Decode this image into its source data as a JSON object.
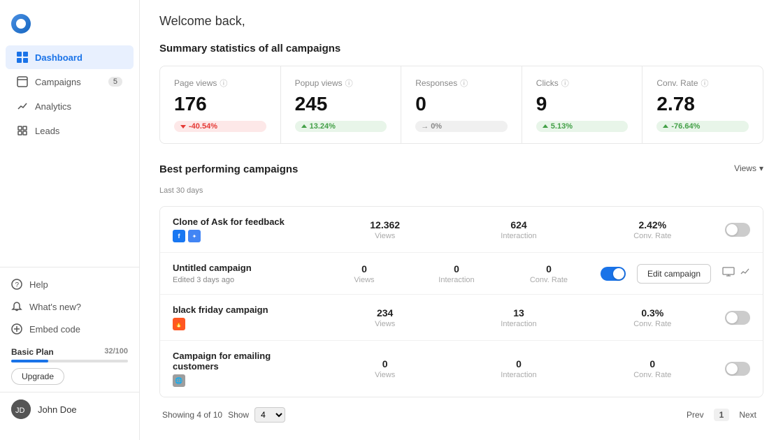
{
  "app": {
    "logo_label": "App Logo"
  },
  "sidebar": {
    "nav_items": [
      {
        "id": "dashboard",
        "label": "Dashboard",
        "icon": "⊞",
        "active": true,
        "badge": null
      },
      {
        "id": "campaigns",
        "label": "Campaigns",
        "icon": "☐",
        "active": false,
        "badge": "5"
      },
      {
        "id": "analytics",
        "label": "Analytics",
        "icon": "↗",
        "active": false,
        "badge": null
      },
      {
        "id": "leads",
        "label": "Leads",
        "icon": "▣",
        "active": false,
        "badge": null
      }
    ],
    "bottom_items": [
      {
        "id": "help",
        "label": "Help",
        "icon": "?"
      },
      {
        "id": "whats-new",
        "label": "What's new?",
        "icon": "🔔"
      },
      {
        "id": "embed-code",
        "label": "Embed code",
        "icon": "⊕"
      }
    ],
    "plan": {
      "label": "Basic Plan",
      "current": "32",
      "max": "100",
      "progress": 32,
      "upgrade_label": "Upgrade"
    },
    "user": {
      "name": "John Doe",
      "avatar_initials": "JD"
    }
  },
  "main": {
    "welcome": "Welcome back,",
    "stats_section_title": "Summary statistics of all campaigns",
    "stats": [
      {
        "label": "Page views",
        "value": "176",
        "change": "-40.54%",
        "direction": "down"
      },
      {
        "label": "Popup views",
        "value": "245",
        "change": "13.24%",
        "direction": "up"
      },
      {
        "label": "Responses",
        "value": "0",
        "change": "0%",
        "direction": "neutral"
      },
      {
        "label": "Clicks",
        "value": "9",
        "change": "5.13%",
        "direction": "up"
      },
      {
        "label": "Conv. Rate",
        "value": "2.78",
        "change": "-76.64%",
        "direction": "up"
      }
    ],
    "best_campaigns_title": "Best performing campaigns",
    "best_campaigns_subtitle": "Last 30 days",
    "views_label": "Views",
    "campaigns": [
      {
        "name": "Clone of Ask for feedback",
        "sub": "",
        "icons": [
          "fb",
          "gads"
        ],
        "views": "12.362",
        "interaction": "624",
        "conv_rate": "2.42%",
        "toggle": false,
        "edit": false
      },
      {
        "name": "Untitled campaign",
        "sub": "Edited 3 days ago",
        "icons": [],
        "views": "0",
        "interaction": "0",
        "conv_rate": "0",
        "toggle": true,
        "edit": true
      },
      {
        "name": "black friday campaign",
        "sub": "",
        "icons": [
          "fire"
        ],
        "views": "234",
        "interaction": "13",
        "conv_rate": "0.3%",
        "toggle": false,
        "edit": false
      },
      {
        "name": "Campaign for emailing customers",
        "sub": "",
        "icons": [
          "globe"
        ],
        "views": "0",
        "interaction": "0",
        "conv_rate": "0",
        "toggle": false,
        "edit": false
      }
    ],
    "table_headers": {
      "views": "Views",
      "interaction": "Interaction",
      "conv_rate": "Conv. Rate"
    },
    "pagination": {
      "showing_text": "Showing 4 of 10",
      "show_label": "Show",
      "show_value": "4",
      "prev_label": "Prev",
      "next_label": "Next",
      "current_page": "1"
    },
    "edit_campaign_label": "Edit campaign"
  }
}
